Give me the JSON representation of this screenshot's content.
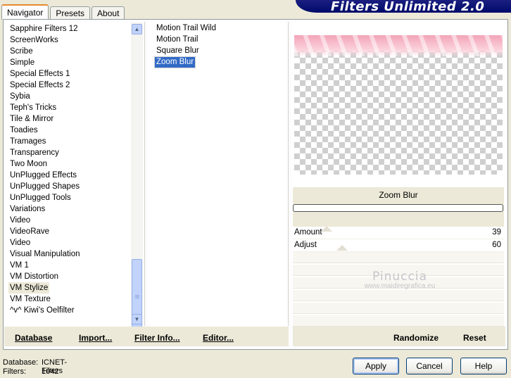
{
  "title": "Filters Unlimited 2.0",
  "tabs": [
    "Navigator",
    "Presets",
    "About"
  ],
  "categories": [
    "Sapphire Filters 12",
    "ScreenWorks",
    "Scribe",
    "Simple",
    "Special Effects 1",
    "Special Effects 2",
    "Sybia",
    "Teph's Tricks",
    "Tile & Mirror",
    "Toadies",
    "Tramages",
    "Transparency",
    "Two Moon",
    "UnPlugged Effects",
    "UnPlugged Shapes",
    "UnPlugged Tools",
    "Variations",
    "Video",
    "VideoRave",
    "Video",
    "Visual Manipulation",
    "VM 1",
    "VM Distortion",
    "VM Stylize",
    "VM Texture",
    "^v^ Kiwi's Oelfilter"
  ],
  "selected_category": "VM Stylize",
  "filters": [
    "Motion Trail Wild",
    "Motion Trail",
    "Square Blur",
    "Zoom Blur"
  ],
  "selected_filter": "Zoom Blur",
  "preview": {
    "filter_name": "Zoom Blur"
  },
  "sliders": [
    {
      "label": "Amount",
      "value": "39"
    },
    {
      "label": "Adjust",
      "value": "60"
    }
  ],
  "watermark": {
    "name": "Pinuccia",
    "url": "www.maidiregrafica.eu"
  },
  "toolbar": {
    "database": "Database",
    "import": "Import...",
    "filter_info": "Filter Info...",
    "editor": "Editor...",
    "randomize": "Randomize",
    "reset": "Reset"
  },
  "status": {
    "database_label": "Database:",
    "database_value": "ICNET-Filters",
    "filters_label": "Filters:",
    "filters_value": "1042"
  },
  "buttons": {
    "apply": "Apply",
    "cancel": "Cancel",
    "help": "Help"
  },
  "colors": {
    "selection": "#316ac5",
    "title_bar": "#0a1478"
  }
}
